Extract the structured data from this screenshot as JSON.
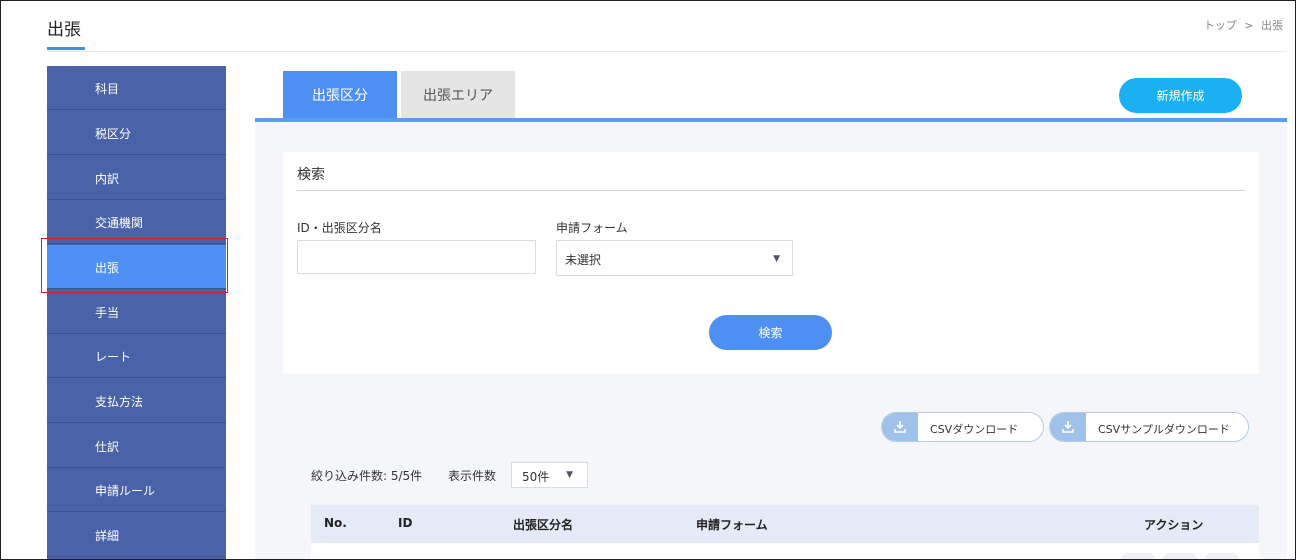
{
  "header": {
    "title": "出張",
    "breadcrumb": [
      "トップ",
      ">",
      "出張"
    ]
  },
  "sidebar": {
    "items": [
      {
        "label": "科目"
      },
      {
        "label": "税区分"
      },
      {
        "label": "内訳"
      },
      {
        "label": "交通機関"
      },
      {
        "label": "出張",
        "active": true
      },
      {
        "label": "手当"
      },
      {
        "label": "レート"
      },
      {
        "label": "支払方法"
      },
      {
        "label": "仕訳"
      },
      {
        "label": "申請ルール"
      },
      {
        "label": "詳細"
      }
    ]
  },
  "tabs": [
    {
      "label": "出張区分",
      "active": true
    },
    {
      "label": "出張エリア",
      "active": false
    }
  ],
  "new_button": "新規作成",
  "search": {
    "title": "検索",
    "id_label": "ID・出張区分名",
    "id_value": "",
    "form_label": "申請フォーム",
    "form_value": "未選択",
    "submit": "検索"
  },
  "csv": {
    "download": "CSVダウンロード",
    "sample_download": "CSVサンプルダウンロード"
  },
  "list": {
    "count_text": "絞り込み件数: 5/5件",
    "per_page_label": "表示件数",
    "per_page_value": "50件"
  },
  "table": {
    "headers": [
      "No.",
      "ID",
      "出張区分名",
      "申請フォーム",
      "アクション"
    ]
  },
  "colors": {
    "sidebar": "#4a63a8",
    "active": "#4d8ff2",
    "new_button": "#1ab0f2",
    "highlight": "#d42020"
  },
  "icons": {
    "dropdown": "caret-down-icon",
    "download": "download-icon"
  }
}
